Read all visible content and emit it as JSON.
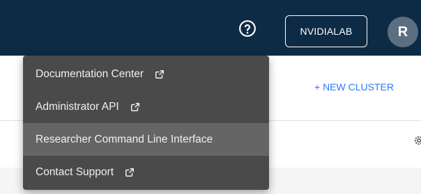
{
  "header": {
    "help_icon": "help-circle-icon",
    "tenant_label": "NVIDIALAB",
    "avatar_initial": "R"
  },
  "main": {
    "new_cluster_label": "+ NEW CLUSTER",
    "row_icon": "gear-icon"
  },
  "help_menu": {
    "items": [
      {
        "label": "Documentation Center",
        "icon": "external-link-icon"
      },
      {
        "label": "Administrator API",
        "icon": "external-link-icon"
      },
      {
        "label": "Researcher Command Line Interface",
        "icon": ""
      },
      {
        "label": "Contact Support",
        "icon": "external-link-icon"
      }
    ]
  },
  "colors": {
    "header_bg": "#0d2b45",
    "menu_bg": "#4a4a4a",
    "menu_highlight": "#656565",
    "accent": "#2979ff"
  }
}
